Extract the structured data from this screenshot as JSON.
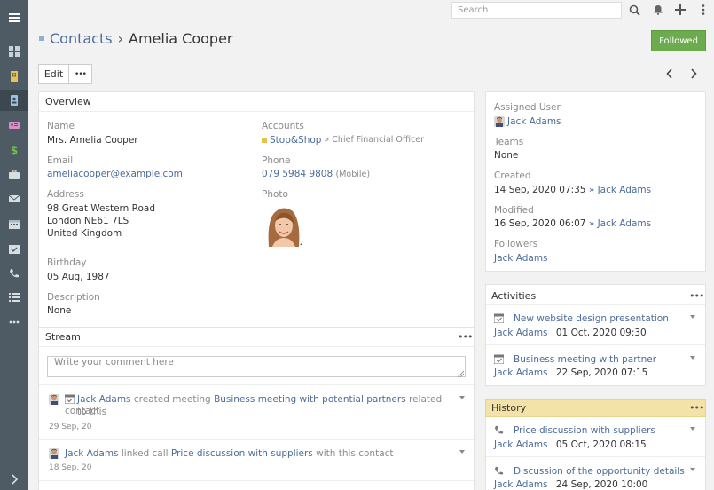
{
  "topbar": {
    "search_placeholder": "Search"
  },
  "header": {
    "scope": "Contacts",
    "separator": "›",
    "record_name": "Amelia Cooper",
    "follow_label": "Followed"
  },
  "actions": {
    "edit_label": "Edit",
    "more_label": "•••"
  },
  "overview": {
    "title": "Overview",
    "name_label": "Name",
    "name_value": "Mrs. Amelia Cooper",
    "accounts_label": "Accounts",
    "account_name": "Stop&Shop",
    "account_role": "» Chief Financial Officer",
    "email_label": "Email",
    "email_value": "ameliacooper@example.com",
    "phone_label": "Phone",
    "phone_value": "079 5984 9808",
    "phone_type": "(Mobile)",
    "address_label": "Address",
    "address_line1": "98 Great Western Road",
    "address_line2": "London NE61 7LS",
    "address_line3": "United Kingdom",
    "photo_label": "Photo",
    "birthday_label": "Birthday",
    "birthday_value": "05 Aug, 1987",
    "description_label": "Description",
    "description_value": "None"
  },
  "stream": {
    "title": "Stream",
    "menu": "•••",
    "comment_placeholder": "Write your comment here",
    "items": [
      {
        "user": "Jack Adams",
        "action": "created meeting",
        "target": "Business meeting with potential partners",
        "suffix": "related to this",
        "suffix2": "contact",
        "date": "29 Sep, 20"
      },
      {
        "user": "Jack Adams",
        "action": "linked call",
        "target": "Price discussion with suppliers",
        "suffix": "with this contact",
        "date": "18 Sep, 20"
      }
    ]
  },
  "side": {
    "assigned_user_label": "Assigned User",
    "assigned_user": "Jack Adams",
    "teams_label": "Teams",
    "teams_value": "None",
    "created_label": "Created",
    "created_value": "14 Sep, 2020 07:35",
    "created_by": "» Jack Adams",
    "modified_label": "Modified",
    "modified_value": "16 Sep, 2020 06:07",
    "modified_by": "» Jack Adams",
    "followers_label": "Followers",
    "followers_value": "Jack Adams"
  },
  "activities": {
    "title": "Activities",
    "menu": "•••",
    "items": [
      {
        "title": "New website design presentation",
        "user": "Jack Adams",
        "date": "01 Oct, 2020 09:30"
      },
      {
        "title": "Business meeting with partner",
        "user": "Jack Adams",
        "date": "22 Sep, 2020 07:15"
      }
    ]
  },
  "history": {
    "title": "History",
    "menu": "•••",
    "items": [
      {
        "title": "Price discussion with suppliers",
        "user": "Jack Adams",
        "date": "05 Oct, 2020 08:15"
      },
      {
        "title": "Discussion of the opportunity details",
        "user": "Jack Adams",
        "date": "24 Sep, 2020 10:00"
      }
    ]
  },
  "colors": {
    "sidebar": "#4e5b64",
    "link": "#4b6c9a",
    "followed": "#6cac4f",
    "history_header": "#f3e3a8"
  }
}
